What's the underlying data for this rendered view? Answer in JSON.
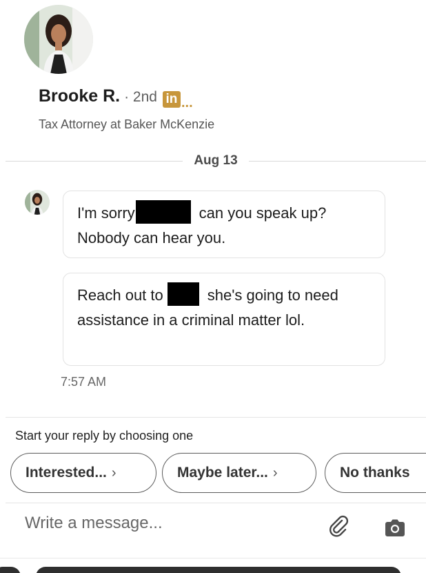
{
  "profile": {
    "name": "Brooke R.",
    "degree": "· 2nd",
    "badge_text": "in",
    "badge_dots": "...",
    "headline": "Tax Attorney at Baker McKenzie"
  },
  "thread": {
    "date": "Aug 13",
    "messages": [
      {
        "text_before": "I'm sorry",
        "text_after": "can you speak up? Nobody can hear you."
      },
      {
        "text_before": "Reach out to",
        "text_after": "she's going to need assistance in a criminal matter lol."
      }
    ],
    "timestamp": "7:57 AM"
  },
  "suggested_replies": {
    "prompt": "Start your reply by choosing one",
    "chips": [
      {
        "label": "Interested...",
        "chevron": "›"
      },
      {
        "label": "Maybe later...",
        "chevron": "›"
      },
      {
        "label": "No thanks",
        "chevron": ""
      }
    ]
  },
  "composer": {
    "placeholder": "Write a message..."
  },
  "icons": {
    "attach": "paperclip-icon",
    "camera": "camera-icon"
  },
  "colors": {
    "premium_gold": "#c7963b",
    "redaction": "#000000"
  }
}
